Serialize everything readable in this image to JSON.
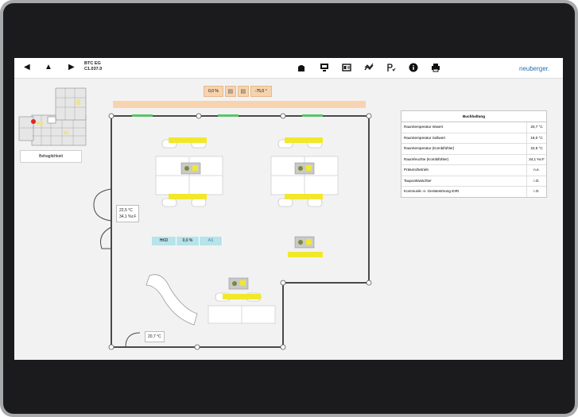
{
  "header": {
    "room_line1": "BTC EG",
    "room_line2": "C1.037.0",
    "brand": "neuberger."
  },
  "navigation": {
    "back_icon": "triangle-left-icon",
    "up_icon": "triangle-up-icon",
    "forward_icon": "triangle-right-icon"
  },
  "toolbar": {
    "icons": [
      "building-icon",
      "monitor-icon",
      "card-icon",
      "trend-icon",
      "schedule-icon",
      "info-icon",
      "print-icon"
    ]
  },
  "sidebar": {
    "button_label": "Behaglichkeit"
  },
  "controls": {
    "percent": "0,0 %",
    "angle": "-75,0 °",
    "blind_icons": [
      "blind-up-icon",
      "blind-down-icon"
    ]
  },
  "floor": {
    "sensor_temp": "22,5 °C",
    "sensor_humidity": "34,1 %r.F",
    "entry_temp": "20,7 °C",
    "hkd_label": "HKD",
    "hkd_value": "0,0 %",
    "hkd_state": "AS"
  },
  "info_panel": {
    "title": "Buchhaltung",
    "rows": [
      {
        "label": "Raumtemperatur Istwert",
        "value": "20,7 °C"
      },
      {
        "label": "Raumtemperatur Sollwert",
        "value": "19,0 °C"
      },
      {
        "label": "Raumtemperatur (Kombifühler)",
        "value": "22,5 °C"
      },
      {
        "label": "Raumfeuchte (Kombifühler)",
        "value": "34,1 %r.F"
      },
      {
        "label": "Präsenzbetrieb",
        "value": "n.e."
      },
      {
        "label": "Taupunktwächter",
        "value": "i.O."
      },
      {
        "label": "Kommunik.-n. Gerätestörung EIRI",
        "value": "i.O."
      }
    ]
  },
  "colors": {
    "accent_yellow": "#f1e82c",
    "window_green": "#5cc46a",
    "facade_orange": "#f8d3b0",
    "hkd_blue": "#b7e3ea"
  }
}
